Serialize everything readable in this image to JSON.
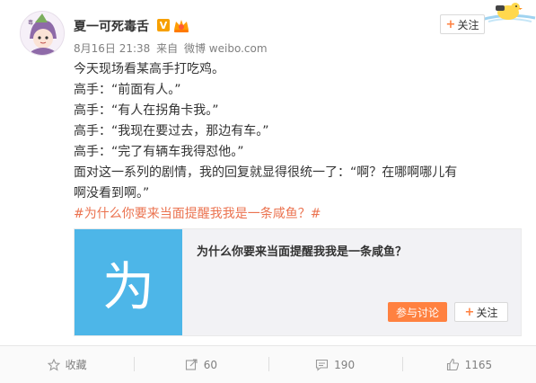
{
  "header": {
    "username": "夏一可死毒舌",
    "verified_badge": "V",
    "follow_label": "关注",
    "follow_plus": "+"
  },
  "meta": {
    "date": "8月16日 21:38",
    "from_label": "来自",
    "source": "微博 weibo.com"
  },
  "post": {
    "lines": [
      "今天现场看某高手打吃鸡。",
      "高手：“前面有人。”",
      "高手：“有人在拐角卡我。”",
      "高手：“我现在要过去，那边有车。”",
      "高手：“完了有辆车我得怼他。”",
      "面对这一系列的剧情，我的回复就显得很统一了：“啊？在哪啊哪儿有啊没看到啊。”"
    ],
    "hashtag": "#为什么你要来当面提醒我我是一条咸鱼？#"
  },
  "card": {
    "image_glyph": "为",
    "title": "为什么你要来当面提醒我我是一条咸鱼？",
    "discuss_label": "参与讨论",
    "follow_label": "关注",
    "follow_plus": "+"
  },
  "actions": {
    "favorite": "收藏",
    "repost": "60",
    "comment": "190",
    "like": "1165"
  },
  "colors": {
    "accent_orange": "#ff8140",
    "hashtag": "#eb7350",
    "card_image": "#4db6e8",
    "verified": "#f7a000"
  },
  "icons": [
    "avatar-illustration",
    "duck-sticker-icon",
    "vip-crown-icon",
    "star-icon",
    "repost-icon",
    "comment-icon",
    "thumbs-up-icon"
  ]
}
